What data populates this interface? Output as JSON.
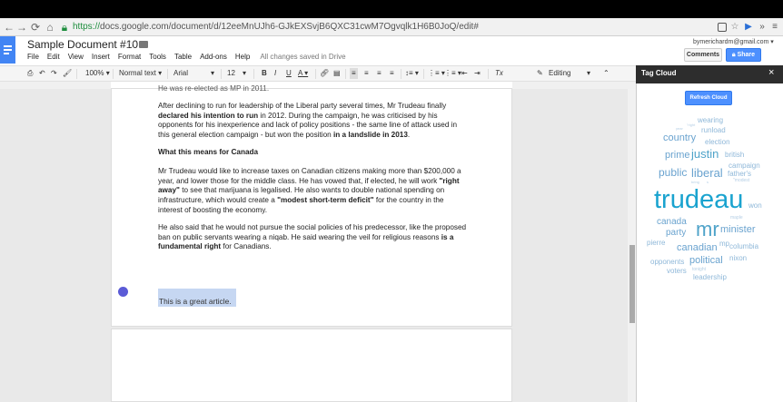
{
  "browser": {
    "url_scheme": "https://",
    "url_rest": "docs.google.com/document/d/12eeMnUJh6-GJkEXSvjB6QXC31cwM7Ogvqlk1H6B0JoQ/edit#",
    "back_icon": "back-arrow-icon",
    "forward_icon": "forward-arrow-icon",
    "reload_icon": "reload-icon",
    "home_icon": "home-icon"
  },
  "doc": {
    "title": "Sample Document #10",
    "menu": [
      "File",
      "Edit",
      "View",
      "Insert",
      "Format",
      "Tools",
      "Table",
      "Add-ons",
      "Help"
    ],
    "saved_status": "All changes saved in Drive"
  },
  "account": {
    "email": "bymerichardm@gmail.com",
    "comments_label": "Comments",
    "share_label": "Share"
  },
  "toolbar": {
    "zoom": "100%",
    "style": "Normal text",
    "font": "Arial",
    "size": "12",
    "bold": "B",
    "italic": "I",
    "underline": "U",
    "text_color": "A",
    "clear_format": "Tx",
    "mode": "Editing"
  },
  "content": {
    "top_partial": "He was re-elected as MP in 2011.",
    "p1_a": "After declining to run for leadership of the Liberal party several times, Mr Trudeau finally ",
    "p1_b": "declared his intention to run",
    "p1_c": " in 2012. During the campaign, he was criticised by his opponents for his inexperience and lack of policy positions - the same line of attack used in this general election campaign - but won the position ",
    "p1_d": "in a landslide in 2013",
    "p1_e": ".",
    "heading": "What this means for Canada",
    "p2_a": "Mr Trudeau would like to increase taxes on Canadian citizens making more than $200,000 a year, and lower those for the middle class. He has vowed that, if elected, he will work ",
    "p2_b": "\"right away\"",
    "p2_c": " to see that marijuana is legalised. He also wants to double national spending on infrastructure, which would create a ",
    "p2_d": "\"modest short-term deficit\"",
    "p2_e": " for the country in the interest of boosting the economy.",
    "p3_a": "He also said that he would not pursue the social policies of his predecessor, like the proposed ban on public servants wearing a niqab. He said wearing the veil for religious reasons ",
    "p3_b": "is a fundamental right",
    "p3_c": " for Canadians.",
    "selected_text": "This is a great article."
  },
  "panel": {
    "title": "Tag Cloud",
    "close": "×",
    "refresh_label": "Refresh Cloud",
    "words": {
      "wearing": "wearing",
      "right": "\"right",
      "year": "year",
      "runload": "runload",
      "country": "country",
      "election": "election",
      "prime": "prime",
      "justin": "justin",
      "british": "british",
      "campaign": "campaign",
      "public": "public",
      "liberal": "liberal",
      "fathers": "father's",
      "bring": "bring",
      "s": "s",
      "modest": "\"modest",
      "trudeau": "trudeau",
      "won": "won",
      "canada": "canada",
      "maple": "maple",
      "mr": "mr",
      "minister": "minister",
      "party": "party",
      "pierre": "pierre",
      "canadian": "canadian",
      "mp": "mp",
      "columbia": "columbia",
      "opponents": "opponents",
      "political": "political",
      "nixon": "nixon",
      "voters": "voters",
      "tonight": "tonight",
      "leadership": "leadership"
    }
  }
}
